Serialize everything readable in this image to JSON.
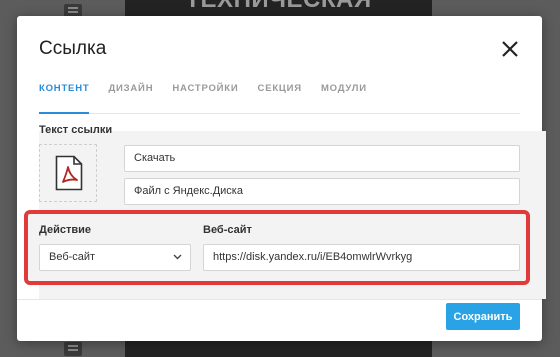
{
  "background": {
    "heading": "ТЕХНИЧЕСКАЯ"
  },
  "modal": {
    "title": "Ссылка",
    "close_icon": "close-icon",
    "tabs": [
      {
        "label": "КОНТЕНТ",
        "active": true
      },
      {
        "label": "ДИЗАЙН",
        "active": false
      },
      {
        "label": "НАСТРОЙКИ",
        "active": false
      },
      {
        "label": "СЕКЦИЯ",
        "active": false
      },
      {
        "label": "МОДУЛИ",
        "active": false
      }
    ],
    "link_text": {
      "label": "Текст ссылки",
      "file_icon": "pdf-file-icon",
      "title_value": "Скачать",
      "subtitle_value": "Файл с Яндекс.Диска"
    },
    "action": {
      "label": "Действие",
      "selected": "Веб-сайт"
    },
    "website": {
      "label": "Веб-сайт",
      "value": "https://disk.yandex.ru/i/EB4omwlrWvrkyg"
    },
    "save_label": "Сохранить"
  },
  "colors": {
    "accent": "#2a8bd6",
    "save_button": "#29a3e6",
    "highlight_border": "#e03a3a",
    "pdf_icon": "#b0271f"
  }
}
